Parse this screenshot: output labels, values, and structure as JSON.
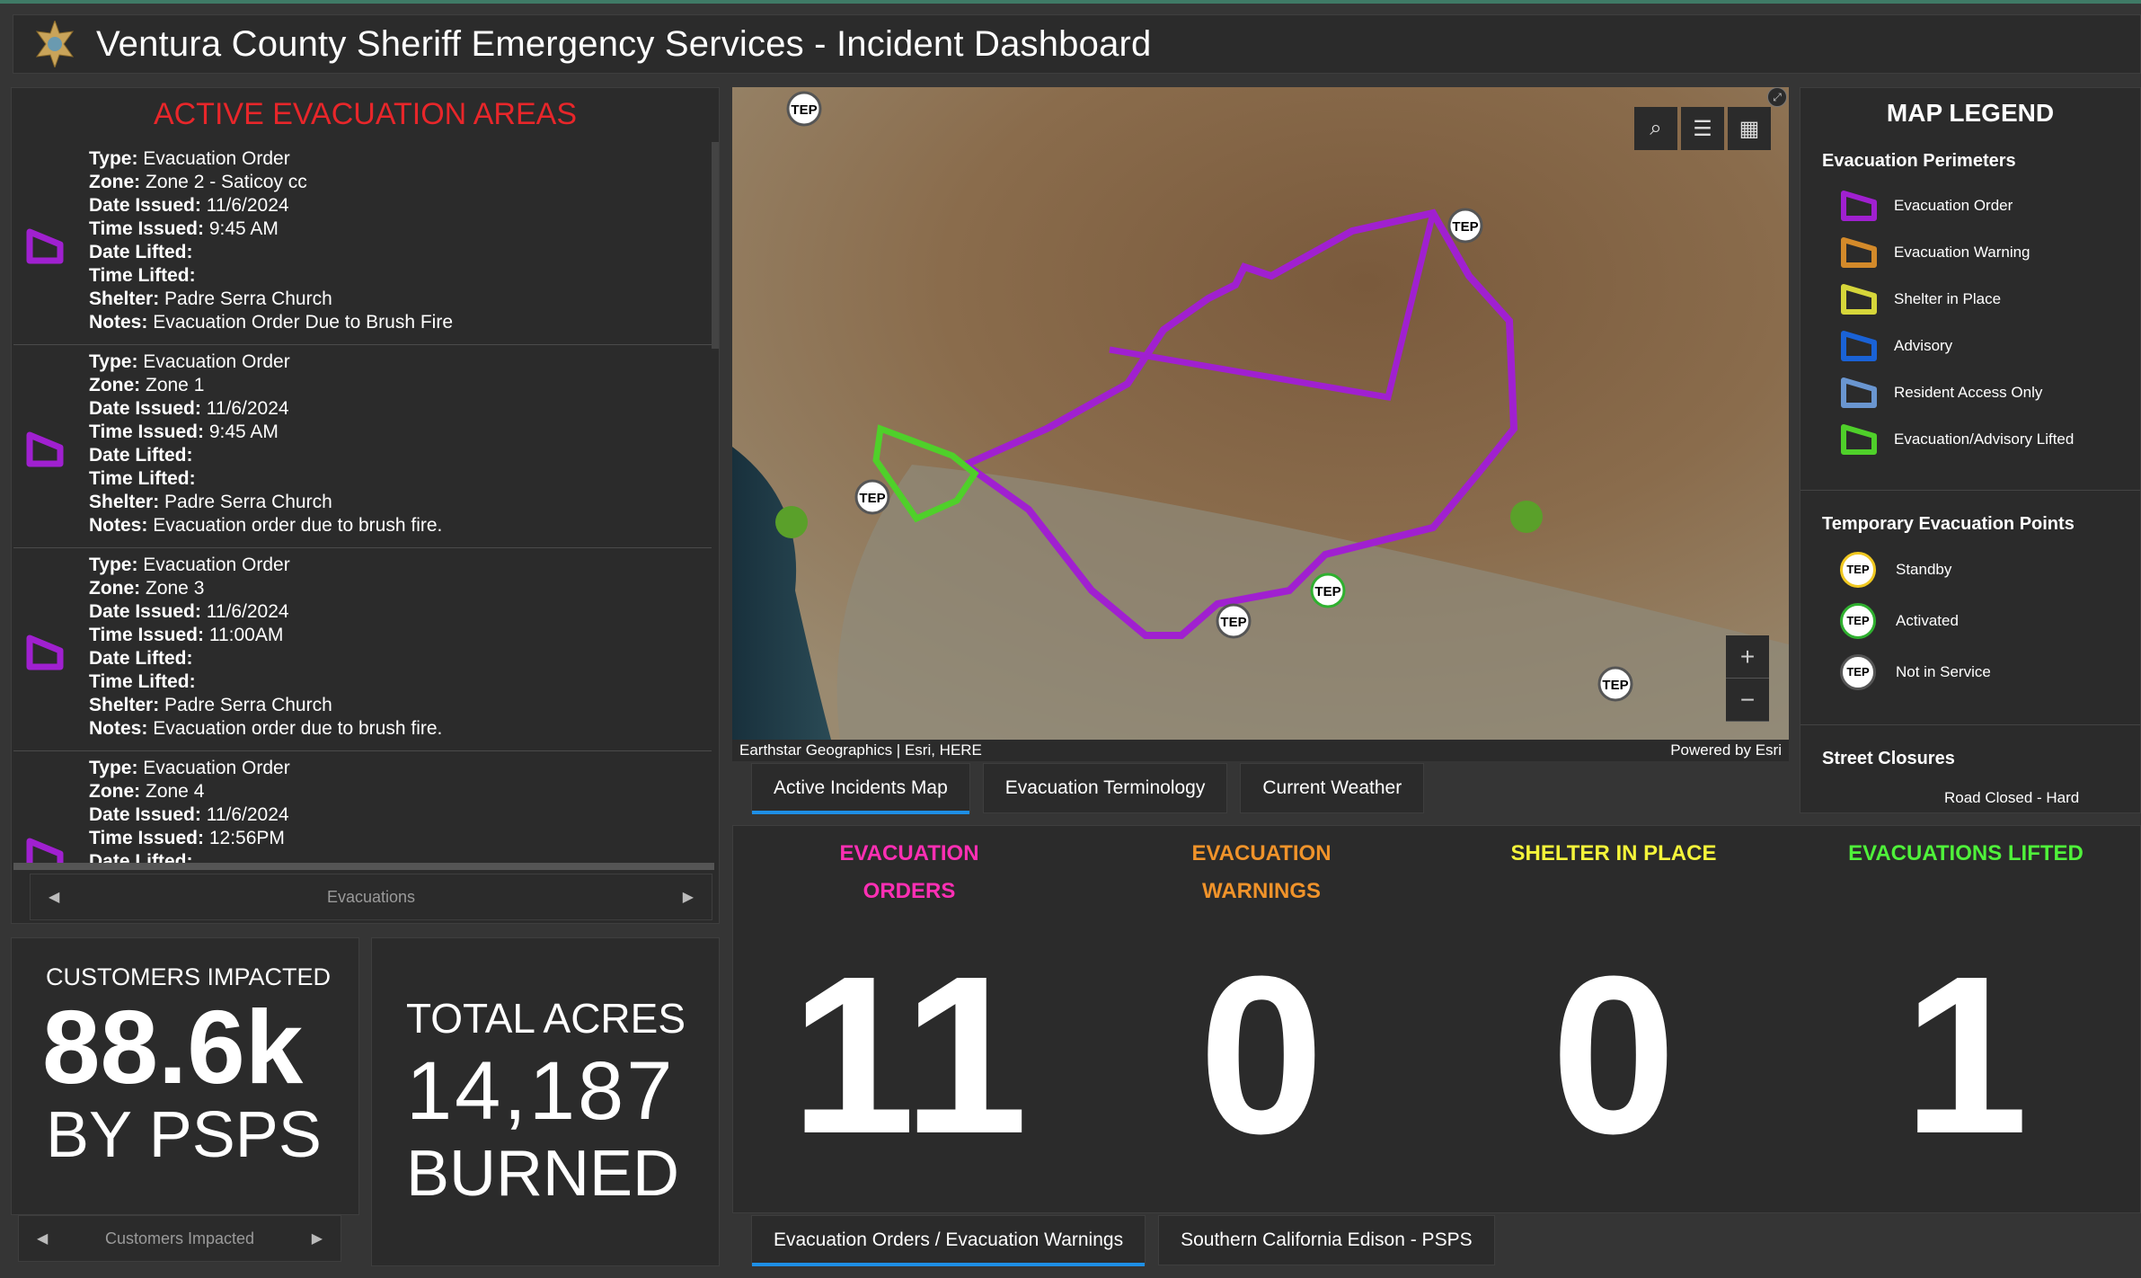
{
  "header": {
    "title": "Ventura County Sheriff Emergency Services - Incident Dashboard"
  },
  "evacuations": {
    "title": "ACTIVE EVACUATION AREAS",
    "pager_label": "Evacuations",
    "labels": {
      "type": "Type:",
      "zone": "Zone:",
      "date_issued": "Date Issued:",
      "time_issued": "Time Issued:",
      "date_lifted": "Date Lifted:",
      "time_lifted": "Time Lifted:",
      "shelter": "Shelter:",
      "notes": "Notes:"
    },
    "items": [
      {
        "type": "Evacuation Order",
        "zone": "Zone 2 - Saticoy cc",
        "date_issued": "11/6/2024",
        "time_issued": "9:45 AM",
        "date_lifted": "",
        "time_lifted": "",
        "shelter": "Padre Serra Church",
        "notes": "Evacuation Order Due to Brush Fire"
      },
      {
        "type": "Evacuation Order",
        "zone": "Zone 1",
        "date_issued": "11/6/2024",
        "time_issued": "9:45 AM",
        "date_lifted": "",
        "time_lifted": "",
        "shelter": "Padre Serra Church",
        "notes": "Evacuation order due to brush fire."
      },
      {
        "type": "Evacuation Order",
        "zone": "Zone 3",
        "date_issued": "11/6/2024",
        "time_issued": "11:00AM",
        "date_lifted": "",
        "time_lifted": "",
        "shelter": "Padre Serra Church",
        "notes": "Evacuation order due to brush fire."
      },
      {
        "type": "Evacuation Order",
        "zone": "Zone 4",
        "date_issued": "11/6/2024",
        "time_issued": "12:56PM",
        "date_lifted": "",
        "time_lifted": "",
        "shelter": "",
        "notes": ""
      }
    ]
  },
  "map": {
    "attribution": "Earthstar Geographics | Esri, HERE",
    "powered_by": "Powered by Esri",
    "marker_label": "TEP",
    "zoom_in": "+",
    "zoom_out": "−"
  },
  "map_tabs": [
    "Active Incidents Map",
    "Evacuation Terminology",
    "Current Weather"
  ],
  "legend": {
    "title": "MAP LEGEND",
    "perimeters_title": "Evacuation Perimeters",
    "perimeters": [
      {
        "label": "Evacuation Order",
        "color": "#a020d0"
      },
      {
        "label": "Evacuation Warning",
        "color": "#d38a2a"
      },
      {
        "label": "Shelter in Place",
        "color": "#d6d63a"
      },
      {
        "label": "Advisory",
        "color": "#1a62d6"
      },
      {
        "label": "Resident Access Only",
        "color": "#6a96d0"
      },
      {
        "label": "Evacuation/Advisory Lifted",
        "color": "#4fd02a"
      }
    ],
    "tep_title": "Temporary Evacuation Points",
    "teps": [
      {
        "label": "Standby",
        "color": "#f0c820"
      },
      {
        "label": "Activated",
        "color": "#2fb02f"
      },
      {
        "label": "Not in Service",
        "color": "#555555"
      }
    ],
    "closures_title": "Street Closures",
    "closure_item": "Road Closed - Hard"
  },
  "stats": [
    {
      "label_1": "EVACUATION",
      "label_2": "ORDERS",
      "value": "11",
      "color": "#ff2fb4"
    },
    {
      "label_1": "EVACUATION",
      "label_2": "WARNINGS",
      "value": "0",
      "color": "#f0932a"
    },
    {
      "label_1": "SHELTER IN PLACE",
      "label_2": "",
      "value": "0",
      "color": "#f4f43a"
    },
    {
      "label_1": "EVACUATIONS LIFTED",
      "label_2": "",
      "value": "1",
      "color": "#4ff23a"
    }
  ],
  "stats_tabs": [
    "Evacuation Orders / Evacuation Warnings",
    "Southern California Edison - PSPS"
  ],
  "customers": {
    "line1": "CUSTOMERS IMPACTED",
    "value": "88.6k",
    "line3": "BY PSPS",
    "pager_label": "Customers Impacted"
  },
  "acres": {
    "line1": "TOTAL ACRES",
    "value": "14,187",
    "line3": "BURNED"
  }
}
